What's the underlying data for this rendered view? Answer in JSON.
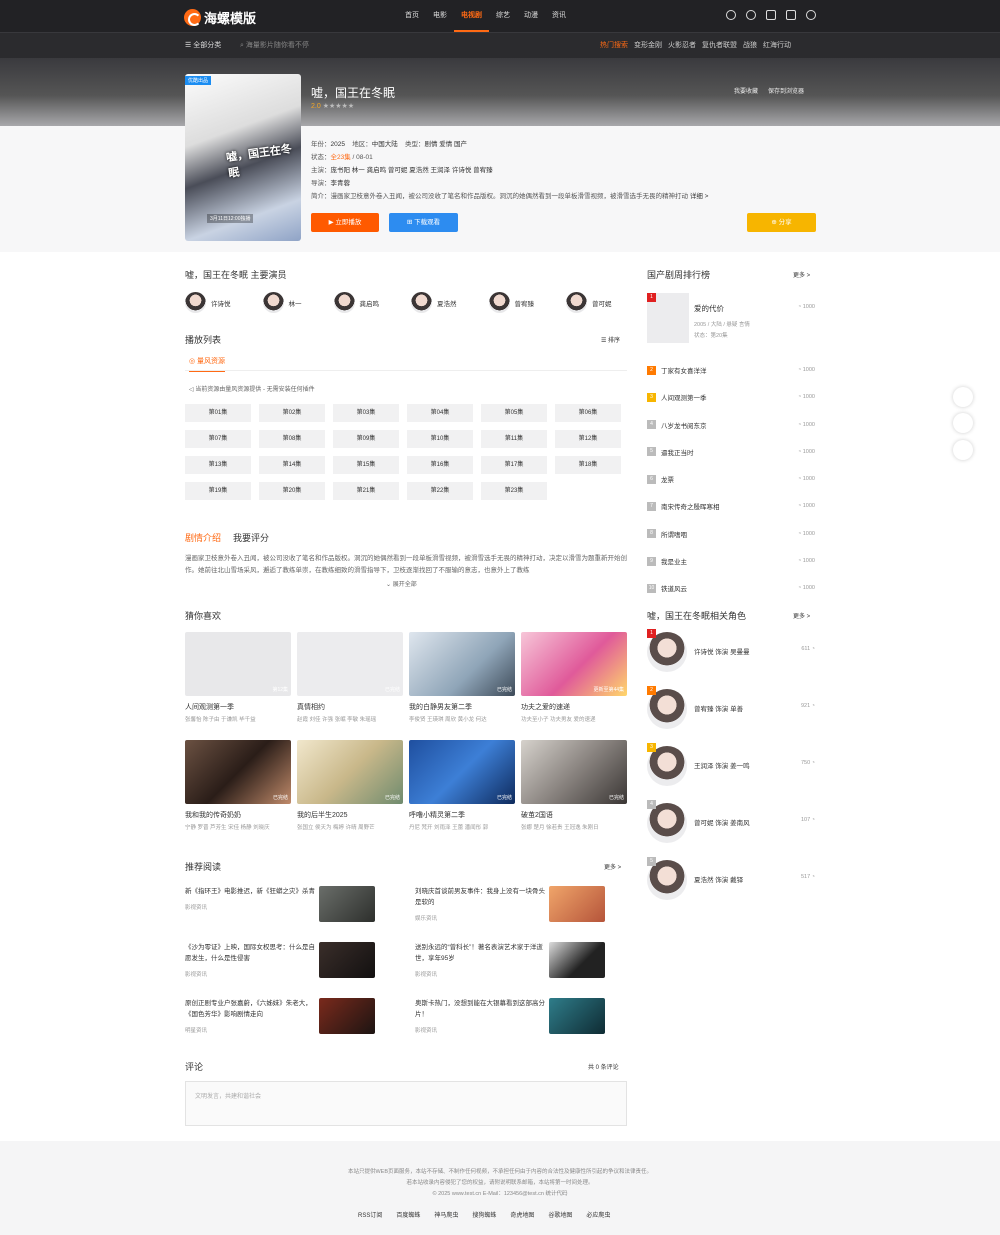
{
  "site": {
    "logo": "海螺模版"
  },
  "nav": {
    "items": [
      "首页",
      "电影",
      "电视剧",
      "综艺",
      "动漫",
      "资讯"
    ],
    "active": 2
  },
  "subnav": {
    "all_category": "全部分类",
    "search_placeholder": "海量影片随你看不停",
    "hot_label": "热门搜索",
    "hot": [
      "变形金刚",
      "火影忍者",
      "复仇者联盟",
      "战狼",
      "红海行动"
    ]
  },
  "detail": {
    "badge": "优酷出品",
    "poster_title": "嘘，国王在冬眠",
    "poster_date": "3月11日12:00独播",
    "title": "嘘，国王在冬眠",
    "score": "2.0",
    "stars": "★★★★★",
    "fav": "我要收藏",
    "save": "保存到浏览器",
    "year_label": "年份：",
    "year": "2025",
    "area_label": "地区：",
    "area": "中国大陆",
    "type_label": "类型：",
    "type": "剧情 爱情 国产",
    "status_label": "状态：",
    "status": "全23集",
    "status_date": "/ 08-01",
    "cast_label": "主演：",
    "cast": "庞书阳 林一 龚启鸣 曾可妮 夏浩然 王润泽 许诗悦 曾宥臻",
    "director_label": "导演：",
    "director": "李青蓉",
    "intro_label": "简介：",
    "intro": "漫画家卫枝意外卷入丑闻，被公司没收了笔名和作品版权。洞沉的她偶然看到一段单板滑雪视频，被滑雪选手无畏的精神打动",
    "detail_link": "详细 >",
    "play": "▶ 立即播放",
    "download": "⊞ 下载观看",
    "share": "⊕ 分享"
  },
  "actors": {
    "heading": "嘘，国王在冬眠 主要演员",
    "list": [
      "许诗悦",
      "林一",
      "龚启鸣",
      "夏浩然",
      "曾宥臻",
      "曾可妮"
    ]
  },
  "playlist": {
    "heading": "播放列表",
    "sort": "☰ 排序",
    "source": "◎ 量风资源",
    "notice": "◁ 当前资源由量风资源提供 - 无需安装任何插件",
    "episodes": [
      "第01集",
      "第02集",
      "第03集",
      "第04集",
      "第05集",
      "第06集",
      "第07集",
      "第08集",
      "第09集",
      "第10集",
      "第11集",
      "第12集",
      "第13集",
      "第14集",
      "第15集",
      "第16集",
      "第17集",
      "第18集",
      "第19集",
      "第20集",
      "第21集",
      "第22集",
      "第23集"
    ]
  },
  "plot": {
    "tab1": "剧情介绍",
    "tab2": "我要评分",
    "text": "漫画家卫枝意外卷入丑闻，被公司没收了笔名和作品版权。洞沉的她偶然看到一段单板滑雪视频，被滑雪选手无畏的精神打动，决定以滑雪为题重新开始创作。她前往北山雪场采风，邂逅了教练单崇，在教练细致的滑雪指导下，卫枝逐渐找回了不服输的意志，也意外上了教练",
    "expand": "展开全部"
  },
  "guess": {
    "heading": "猜你喜欢",
    "items": [
      {
        "title": "人间观测第一季",
        "cast": "张馨怡 陈子由 于谦凯 毕千益",
        "tag": "第12集"
      },
      {
        "title": "真情相约",
        "cast": "赵霞 刘佳 许强 张岷 李敏 朱瑶瑶",
        "tag": "已完结"
      },
      {
        "title": "我的白静男友第二季",
        "cast": "李俊贤 王瑛琪 周欣 黄小龙 何达",
        "tag": "已完结"
      },
      {
        "title": "功夫之爱的速递",
        "cast": "功夫至小子 功夫男友 爱的速递",
        "tag": "更新至第44集"
      },
      {
        "title": "我和我的传奇奶奶",
        "cast": "宁静 罗晋 芦芳生 宋佳 杨静 刘晓庆",
        "tag": "已完结"
      },
      {
        "title": "我的后半生2025",
        "cast": "张国立 侯天为 梅婷 许晴 周野芒",
        "tag": "已完结"
      },
      {
        "title": "呼噜小精灵第二季",
        "cast": "丹尼 梵开 刘雨泽 王蕾 潘闻彤 郭",
        "tag": "已完结"
      },
      {
        "title": "破茧2国语",
        "cast": "张娜 楚月 徐若贵 王冠逸 朱刚日",
        "tag": "已完结"
      }
    ]
  },
  "reading": {
    "heading": "推荐阅读",
    "more": "更多 >",
    "items": [
      {
        "title": "新《指环王》电影推迟，新《狂蟒之灾》杀青",
        "cat": "影视资讯"
      },
      {
        "title": "刘晓庆首谈前男友事件：我身上没有一块骨头是软的",
        "cat": "娱乐资讯"
      },
      {
        "title": "《沙为零证》上映，国际女权思考：什么是自愿发生，什么是性侵害",
        "cat": "影视资讯"
      },
      {
        "title": "送别永远的“曾科长”！著名表演艺术家于洋逝世，享年95岁",
        "cat": "影视资讯"
      },
      {
        "title": "原创正剧专业户张嘉蔚，《六姊妹》朱老大，《国色芳华》影响剧情走向",
        "cat": "明星资讯"
      },
      {
        "title": "奥斯卡热门，没想到能在大银幕看到这部高分片！",
        "cat": "影视资讯"
      }
    ]
  },
  "comment": {
    "heading": "评论",
    "count": "共 0 条评论",
    "placeholder": "文明发言，共建和谐社会"
  },
  "ranking": {
    "heading": "国产剧周排行榜",
    "more": "更多 >",
    "top": {
      "title": "爱的代价",
      "sub": "2005 / 大陆 / 悬疑 言情",
      "status": "状态：第20集",
      "count": "1000"
    },
    "list": [
      {
        "n": "2",
        "title": "丁家有女喜洋洋",
        "count": "1000"
      },
      {
        "n": "3",
        "title": "人间观测第一季",
        "count": "1000"
      },
      {
        "n": "4",
        "title": "八岁龙书阅东京",
        "count": "1000"
      },
      {
        "n": "5",
        "title": "逼我正当时",
        "count": "1000"
      },
      {
        "n": "6",
        "title": "龙票",
        "count": "1000"
      },
      {
        "n": "7",
        "title": "南宋传奇之殷晖寒相",
        "count": "1000"
      },
      {
        "n": "8",
        "title": "所谓嗜咽",
        "count": "1000"
      },
      {
        "n": "9",
        "title": "我是业主",
        "count": "1000"
      },
      {
        "n": "10",
        "title": "铁道风云",
        "count": "1000"
      }
    ]
  },
  "roles": {
    "heading": "嘘，国王在冬眠相关角色",
    "more": "更多 >",
    "list": [
      {
        "n": "1",
        "name": "许诗悦 饰演 吴曼曼",
        "count": "611"
      },
      {
        "n": "2",
        "name": "曾宥臻 饰演 单善",
        "count": "921"
      },
      {
        "n": "3",
        "name": "王润泽 饰演 姜一鸣",
        "count": "750"
      },
      {
        "n": "4",
        "name": "曾可妮 饰演 姜南风",
        "count": "107"
      },
      {
        "n": "5",
        "name": "夏浩然 饰演 戴铎",
        "count": "517"
      }
    ]
  },
  "footer": {
    "line1": "本站只提供WEB页面服务，本站不存储、不制作任何视频，不承担任何由于内容的合法性及健康性所引起的争议和法律责任。",
    "line2": "若本站收录内容侵犯了您的权益，请附说明联系邮箱，本站将第一时间处理。",
    "line3": "© 2025 www.test.cn  E-Mail：123456@test.cn  统计代码",
    "links": [
      "RSS订阅",
      "百度蜘蛛",
      "神马爬虫",
      "搜狗蜘蛛",
      "奇虎地图",
      "谷歌地图",
      "必应爬虫"
    ]
  },
  "colors": {
    "accent": "#ff6a14",
    "blue": "#2d8cf0",
    "yellow": "#f7b500",
    "dark": "#222225"
  }
}
